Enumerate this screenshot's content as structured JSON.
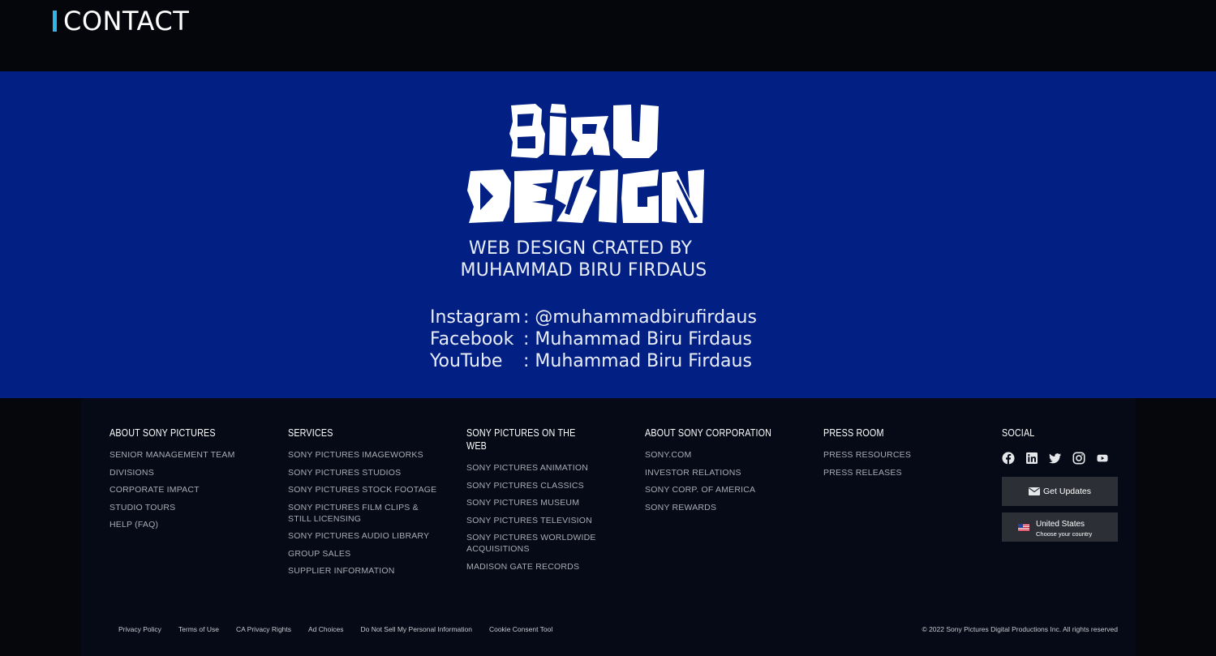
{
  "header": {
    "title": "CONTACT"
  },
  "banner": {
    "logo_text": [
      "BIRU",
      "DESIGN"
    ],
    "credit_line1": "WEB DESIGN CRATED BY",
    "credit_line2": "MUHAMMAD BIRU FIRDAUS",
    "contacts": [
      {
        "label": "Instagram",
        "value": ": @muhammadbirufirdaus"
      },
      {
        "label": "Facebook",
        "value": ": Muhammad Biru Firdaus"
      },
      {
        "label": "YouTube",
        "value": ": Muhammad Biru Firdaus"
      }
    ]
  },
  "footer": {
    "columns": [
      {
        "heading": "ABOUT SONY PICTURES",
        "links": [
          "SENIOR MANAGEMENT TEAM",
          "DIVISIONS",
          "CORPORATE IMPACT",
          "STUDIO TOURS",
          "HELP (FAQ)"
        ]
      },
      {
        "heading": "SERVICES",
        "links": [
          "SONY PICTURES IMAGEWORKS",
          "SONY PICTURES STUDIOS",
          "SONY PICTURES STOCK FOOTAGE",
          "SONY PICTURES FILM CLIPS & STILL LICENSING",
          "SONY PICTURES AUDIO LIBRARY",
          "GROUP SALES",
          "SUPPLIER INFORMATION"
        ]
      },
      {
        "heading": "SONY PICTURES ON THE WEB",
        "links": [
          "SONY PICTURES ANIMATION",
          "SONY PICTURES CLASSICS",
          "SONY PICTURES MUSEUM",
          "SONY PICTURES TELEVISION",
          "SONY PICTURES WORLDWIDE ACQUISITIONS",
          "MADISON GATE RECORDS"
        ]
      },
      {
        "heading": "ABOUT SONY CORPORATION",
        "links": [
          "SONY.COM",
          "INVESTOR RELATIONS",
          "SONY CORP. OF AMERICA",
          "SONY REWARDS"
        ]
      },
      {
        "heading": "PRESS ROOM",
        "links": [
          "PRESS RESOURCES",
          "PRESS RELEASES"
        ]
      }
    ],
    "social": {
      "heading": "SOCIAL",
      "icons": [
        "facebook-icon",
        "linkedin-icon",
        "twitter-icon",
        "instagram-icon",
        "youtube-icon"
      ],
      "updates_label": "Get Updates",
      "country_label": "United States",
      "country_sub": "Choose your country"
    },
    "legal": [
      "Privacy Policy",
      "Terms of Use",
      "CA Privacy Rights",
      "Ad Choices",
      "Do Not Sell My Personal Information",
      "Cookie Consent Tool"
    ],
    "copyright": "© 2022 Sony Pictures Digital Productions Inc. All rights reserved"
  },
  "colors": {
    "accent": "#2eb6ea",
    "banner": "#022084",
    "background": "#05070d"
  }
}
